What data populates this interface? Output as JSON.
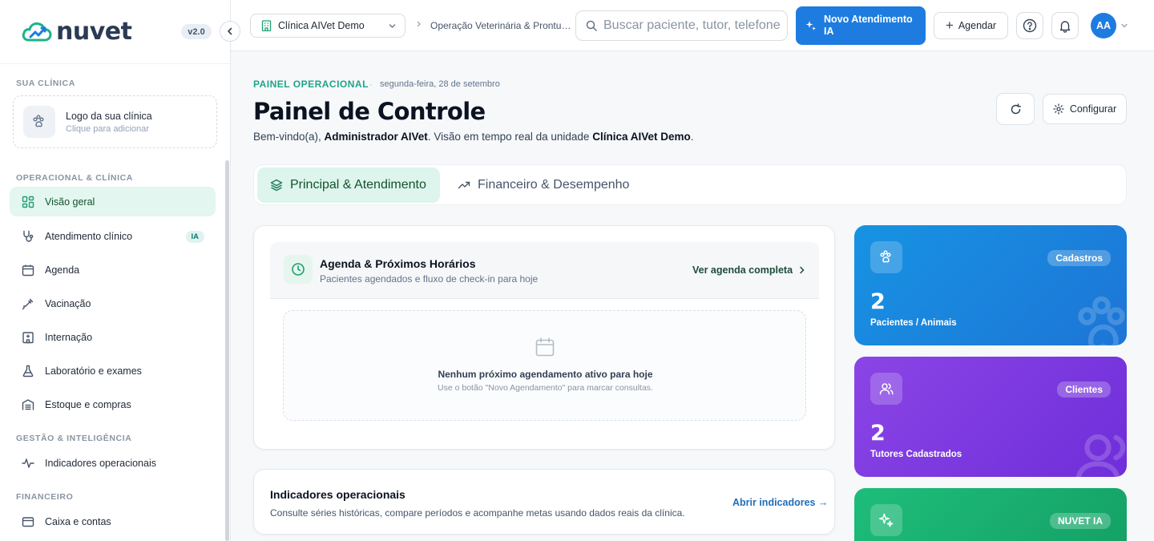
{
  "brand": {
    "name": "nuvet",
    "version": "v2.0"
  },
  "sidebar": {
    "clinic_section": "SUA CLÍNICA",
    "logo_title": "Logo da sua clínica",
    "logo_sub": "Clique para adicionar",
    "sections": {
      "operacional": "OPERACIONAL & CLÍNICA",
      "gestao": "GESTÃO & INTELIGÊNCIA",
      "financeiro": "FINANCEIRO"
    },
    "items": [
      {
        "label": "Visão geral",
        "icon": "grid-icon"
      },
      {
        "label": "Atendimento clínico",
        "icon": "stethoscope-icon",
        "badge": "IA"
      },
      {
        "label": "Agenda",
        "icon": "calendar-icon"
      },
      {
        "label": "Vacinação",
        "icon": "syringe-icon"
      },
      {
        "label": "Internação",
        "icon": "hospital-icon"
      },
      {
        "label": "Laboratório e exames",
        "icon": "flask-icon"
      },
      {
        "label": "Estoque e compras",
        "icon": "warehouse-icon"
      },
      {
        "label": "Indicadores operacionais",
        "icon": "activity-icon"
      },
      {
        "label": "Caixa e contas",
        "icon": "wallet-icon"
      }
    ]
  },
  "topbar": {
    "clinic": "Clínica AIVet Demo",
    "breadcrumb": "Operação Veterinária & Prontuários",
    "search_placeholder": "Buscar paciente, tutor, telefone",
    "new_attendance": "Novo Atendimento IA",
    "schedule": "Agendar",
    "avatar": "AA"
  },
  "header": {
    "eyebrow": "PAINEL OPERACIONAL",
    "date": "segunda-feira, 28 de setembro",
    "title": "Painel de Controle",
    "welcome_prefix": "Bem-vindo(a), ",
    "user": "Administrador AIVet",
    "welcome_mid": ". Visão em tempo real da unidade ",
    "unit": "Clínica AIVet Demo",
    "welcome_end": ".",
    "configure": "Configurar"
  },
  "tabs": [
    {
      "label": "Principal & Atendimento"
    },
    {
      "label": "Financeiro & Desempenho"
    }
  ],
  "agenda": {
    "title": "Agenda & Próximos Horários",
    "subtitle": "Pacientes agendados e fluxo de check-in para hoje",
    "link": "Ver agenda completa",
    "empty_title": "Nenhum próximo agendamento ativo para hoje",
    "empty_sub": "Use o botão \"Novo Agendamento\" para marcar consultas."
  },
  "indicators": {
    "title": "Indicadores operacionais",
    "subtitle": "Consulte séries históricas, compare períodos e acompanhe metas usando dados reais da clínica.",
    "link": "Abrir indicadores →"
  },
  "stats": [
    {
      "tag": "Cadastros",
      "value": "2",
      "label": "Pacientes / Animais",
      "color": "#1a86df"
    },
    {
      "tag": "Clientes",
      "value": "2",
      "label": "Tutores Cadastrados",
      "color": "#7c3aed"
    },
    {
      "tag": "NUVET IA",
      "color": "#18b071"
    }
  ],
  "colors": {
    "accent": "#1e7ce0",
    "teal": "#20a48c",
    "active_bg": "#e3f6ef"
  }
}
